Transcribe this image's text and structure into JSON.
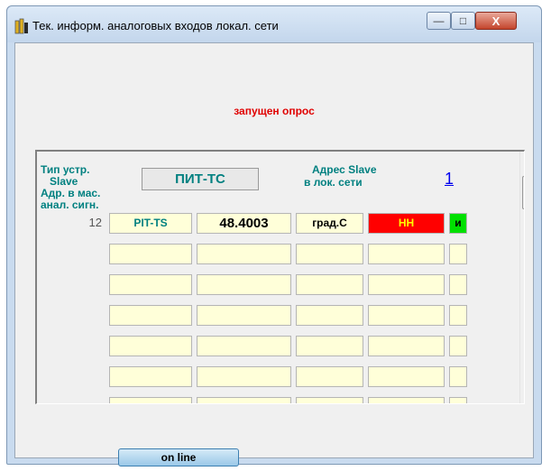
{
  "window": {
    "title": "Тек. информ. аналоговых входов  локал. сети",
    "controls": {
      "minimize": "—",
      "maximize": "□",
      "close": "X"
    }
  },
  "status_text": "запущен опрос",
  "header": {
    "device_type_label_1": "Тип устр.",
    "device_type_label_2": "Slave",
    "array_addr_label_1": "Адр. в мас.",
    "array_addr_label_2": "анал. сигн.",
    "device_type_value": "ПИТ-ТС",
    "slave_addr_label_1": "Адрес Slave",
    "slave_addr_label_2": "в лок.  сети",
    "slave_addr_value": "1"
  },
  "rows": [
    {
      "num": "12",
      "name": "PIT-TS",
      "value": "48.4003",
      "unit": "град.С",
      "alarm": "НН",
      "flag": "и",
      "alarm_color": "#ff0000",
      "flag_color": "#00e000"
    },
    {
      "num": "",
      "name": "",
      "value": "",
      "unit": "",
      "alarm": "",
      "flag": ""
    },
    {
      "num": "",
      "name": "",
      "value": "",
      "unit": "",
      "alarm": "",
      "flag": ""
    },
    {
      "num": "",
      "name": "",
      "value": "",
      "unit": "",
      "alarm": "",
      "flag": ""
    },
    {
      "num": "",
      "name": "",
      "value": "",
      "unit": "",
      "alarm": "",
      "flag": ""
    },
    {
      "num": "",
      "name": "",
      "value": "",
      "unit": "",
      "alarm": "",
      "flag": ""
    },
    {
      "num": "",
      "name": "",
      "value": "",
      "unit": "",
      "alarm": "",
      "flag": ""
    }
  ],
  "online_button_label": "on line",
  "colors": {
    "label_teal": "#008080",
    "status_red": "#e00000",
    "cell_bg": "#ffffd9"
  }
}
